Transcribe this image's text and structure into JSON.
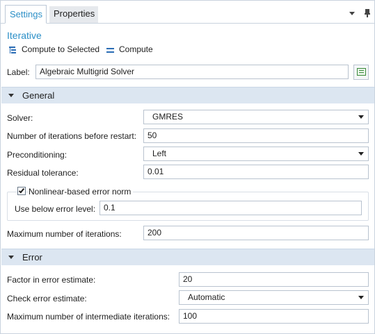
{
  "tabs": {
    "settings": "Settings",
    "properties": "Properties"
  },
  "node_title": "Iterative",
  "commands": {
    "compute_selected": "Compute to Selected",
    "compute": "Compute"
  },
  "label_field": {
    "label": "Label:",
    "value": "Algebraic Multigrid Solver"
  },
  "general": {
    "title": "General",
    "solver": {
      "label": "Solver:",
      "value": "GMRES"
    },
    "restart": {
      "label": "Number of iterations before restart:",
      "value": "50"
    },
    "preconditioning": {
      "label": "Preconditioning:",
      "value": "Left"
    },
    "residual": {
      "label": "Residual tolerance:",
      "value": "0.01"
    },
    "nonlinear_norm": {
      "label": "Nonlinear-based error norm",
      "checked": true
    },
    "error_level": {
      "label": "Use below error level:",
      "value": "0.1"
    },
    "max_iterations": {
      "label": "Maximum number of iterations:",
      "value": "200"
    }
  },
  "error": {
    "title": "Error",
    "factor": {
      "label": "Factor in error estimate:",
      "value": "20"
    },
    "check": {
      "label": "Check error estimate:",
      "value": "Automatic"
    },
    "max_intermediate": {
      "label": "Maximum number of intermediate iterations:",
      "value": "100"
    }
  },
  "colors": {
    "accent": "#2b8fc7",
    "section_bg": "#dce6f1",
    "icon_blue": "#2b6db5"
  }
}
